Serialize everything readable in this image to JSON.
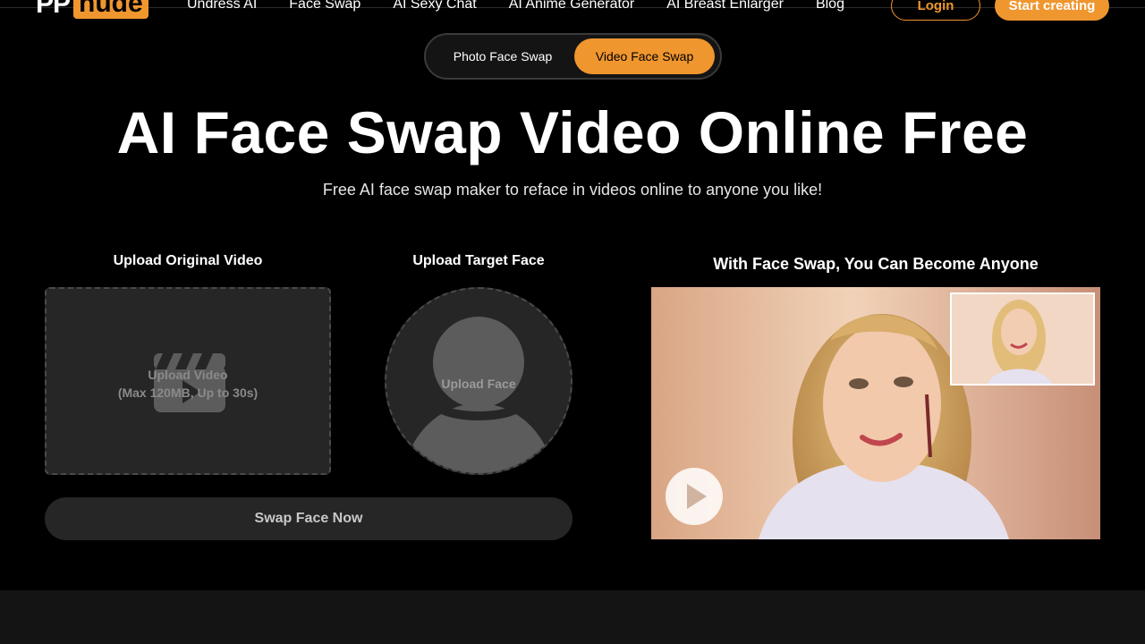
{
  "logo": {
    "part1": "PP",
    "part2": "nude"
  },
  "nav": {
    "links": [
      "Undress AI",
      "Face Swap",
      "AI Sexy Chat",
      "AI Anime Generator",
      "AI Breast Enlarger",
      "Blog"
    ],
    "login_label": "Login",
    "start_label": "Start creating"
  },
  "mode_toggle": {
    "photo_label": "Photo Face Swap",
    "video_label": "Video Face Swap",
    "active": "Video Face Swap"
  },
  "hero": {
    "title": "AI Face Swap Video Online Free",
    "subtitle": "Free AI face swap maker to reface in videos online to anyone you like!"
  },
  "upload": {
    "video_label": "Upload Original Video",
    "video_drop_line1": "Upload Video",
    "video_drop_line2": "(Max 120MB, Up to 30s)",
    "face_label": "Upload Target Face",
    "face_drop_text": "Upload Face",
    "swap_button": "Swap Face Now"
  },
  "demo": {
    "title": "With Face Swap, You Can Become Anyone",
    "icon": "play-icon"
  },
  "colors": {
    "accent": "#f0962f",
    "background": "#000000",
    "panel": "#262626"
  }
}
